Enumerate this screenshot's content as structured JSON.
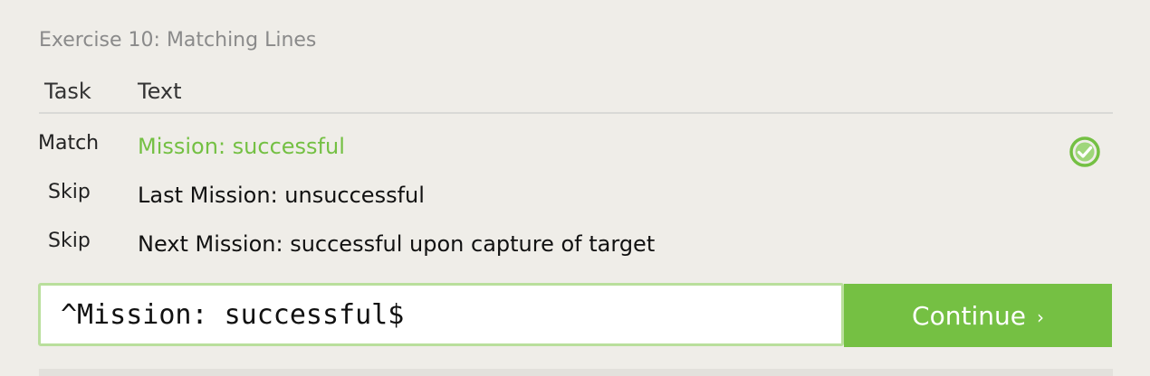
{
  "exercise": {
    "title": "Exercise 10: Matching Lines"
  },
  "table": {
    "headers": {
      "task": "Task",
      "text": "Text"
    },
    "rows": [
      {
        "task": "Match",
        "text": "Mission: successful",
        "status": "matched"
      },
      {
        "task": "Skip",
        "text": "Last Mission: unsuccessful",
        "status": "none"
      },
      {
        "task": "Skip",
        "text": "Next Mission: successful upon capture of target",
        "status": "none"
      }
    ]
  },
  "regex_input": {
    "value": "^Mission: successful$"
  },
  "continue_button": {
    "label": "Continue",
    "chevron": "›"
  },
  "colors": {
    "accent_green": "#75c043",
    "matched_text": "#74c043",
    "background": "#efede8"
  },
  "icons": {
    "row_status": "check-circle-icon"
  }
}
